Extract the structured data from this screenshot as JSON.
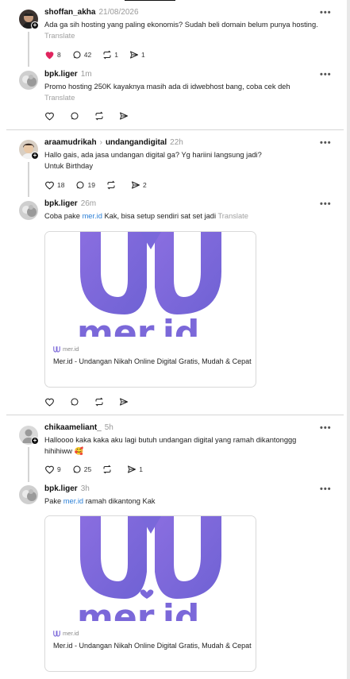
{
  "colors": {
    "liked_heart": "#e0245e",
    "link": "#2a7fd6",
    "muted": "#9a9a9a",
    "brand_purple": "#7b68d9"
  },
  "posts": [
    {
      "username": "shoffan_akha",
      "timestamp": "21/08/2026",
      "text": "Ada ga sih hosting yang paling ekonomis? Sudah beli domain belum punya hosting.",
      "translate": "Translate",
      "likes": "8",
      "replies": "42",
      "reposts": "1",
      "shares": "1",
      "liked": true
    },
    {
      "username": "bpk.liger",
      "timestamp": "1m",
      "text": "Promo hosting 250K kayaknya masih ada di idwebhost bang, coba cek deh",
      "translate": "Translate"
    },
    {
      "username": "araamudrikah",
      "reply_target": "undangandigital",
      "timestamp": "22h",
      "text_line1": "Hallo gais, ada jasa undangan digital ga? Yg hariini langsung jadi?",
      "text_line2": "Untuk Birthday",
      "likes": "18",
      "replies": "19",
      "shares": "2"
    },
    {
      "username": "bpk.liger",
      "timestamp": "26m",
      "text_before_link": "Coba pake ",
      "link_text": "mer.id",
      "text_after_link": " Kak, bisa setup sendiri sat set jadi",
      "translate": "Translate",
      "card": {
        "domain": "mer.id",
        "title": "Mer.id - Undangan Nikah Online Digital Gratis, Mudah & Cepat",
        "image_text": "mer.id"
      }
    },
    {
      "username": "chikaameliant_",
      "timestamp": "5h",
      "text": "Halloooo kaka kaka aku lagi butuh undangan digital yang ramah dikantonggg hihihiww 🥰",
      "likes": "9",
      "replies": "25",
      "shares": "1"
    },
    {
      "username": "bpk.liger",
      "timestamp": "3h",
      "text_before_link": "Pake ",
      "link_text": "mer.id",
      "text_after_link": " ramah dikantong Kak",
      "card": {
        "domain": "mer.id",
        "title": "Mer.id - Undangan Nikah Online Digital Gratis, Mudah & Cepat",
        "image_text": "mer.id"
      }
    }
  ],
  "more_icon_text": "•••"
}
